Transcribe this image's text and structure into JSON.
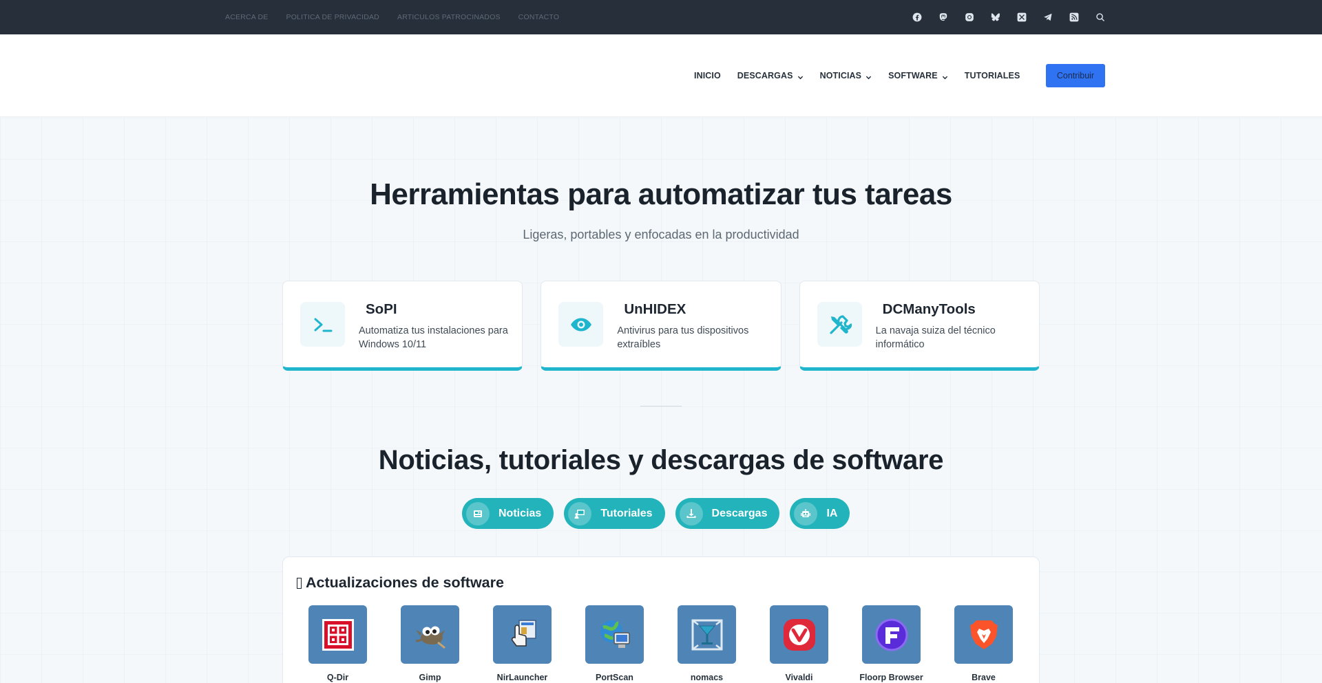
{
  "topbar": {
    "links": [
      "ACERCA DE",
      "POLITICA DE PRIVACIDAD",
      "ARTICULOS PATROCINADOS",
      "CONTACTO"
    ],
    "social": [
      "facebook-icon",
      "mastodon-icon",
      "threads-icon",
      "bluesky-icon",
      "x-icon",
      "telegram-icon",
      "rss-icon",
      "search-icon"
    ]
  },
  "nav": {
    "items": [
      {
        "label": " INICIO",
        "has_dropdown": false
      },
      {
        "label": "DESCARGAS",
        "has_dropdown": true
      },
      {
        "label": "NOTICIAS",
        "has_dropdown": true
      },
      {
        "label": "SOFTWARE",
        "has_dropdown": true
      },
      {
        "label": "TUTORIALES",
        "has_dropdown": false
      }
    ],
    "cta": "Contribuir"
  },
  "hero": {
    "title": "Herramientas para automatizar tus tareas",
    "subtitle": "Ligeras, portables y enfocadas en la productividad"
  },
  "tools": [
    {
      "name": "SoPI",
      "desc": "Automatiza tus instalaciones para Windows 10/11",
      "icon": "terminal-icon"
    },
    {
      "name": "UnHIDEX",
      "desc": "Antivirus para tus dispositivos extraíbles",
      "icon": "eye-icon"
    },
    {
      "name": "DCManyTools",
      "desc": "La navaja suiza del técnico informático",
      "icon": "tools-icon"
    }
  ],
  "section": {
    "title": "Noticias, tutoriales y descargas de software",
    "pills": [
      {
        "label": "Noticias",
        "icon": "newspaper-icon"
      },
      {
        "label": "Tutoriales",
        "icon": "teacher-icon"
      },
      {
        "label": "Descargas",
        "icon": "download-icon"
      },
      {
        "label": "IA",
        "icon": "robot-icon"
      }
    ]
  },
  "updates": {
    "title": "Actualizaciones de software",
    "apps": [
      {
        "name": "Q-Dir ",
        "icon": "qdir-icon"
      },
      {
        "name": "Gimp ",
        "icon": "gimp-icon"
      },
      {
        "name": "NirLauncher ",
        "icon": "nirlauncher-icon"
      },
      {
        "name": "PortScan",
        "icon": "portscan-icon"
      },
      {
        "name": "nomacs",
        "icon": "nomacs-icon"
      },
      {
        "name": "Vivaldi ",
        "icon": "vivaldi-icon"
      },
      {
        "name": "Floorp Browser",
        "icon": "floorp-icon"
      },
      {
        "name": "Brave ",
        "icon": "brave-icon"
      }
    ]
  },
  "colors": {
    "topbar": "#262f3a",
    "accent": "#1fb5cd",
    "pill": "#23b3bb",
    "cta": "#2f72f2",
    "app_tile": "#4e84b6"
  }
}
